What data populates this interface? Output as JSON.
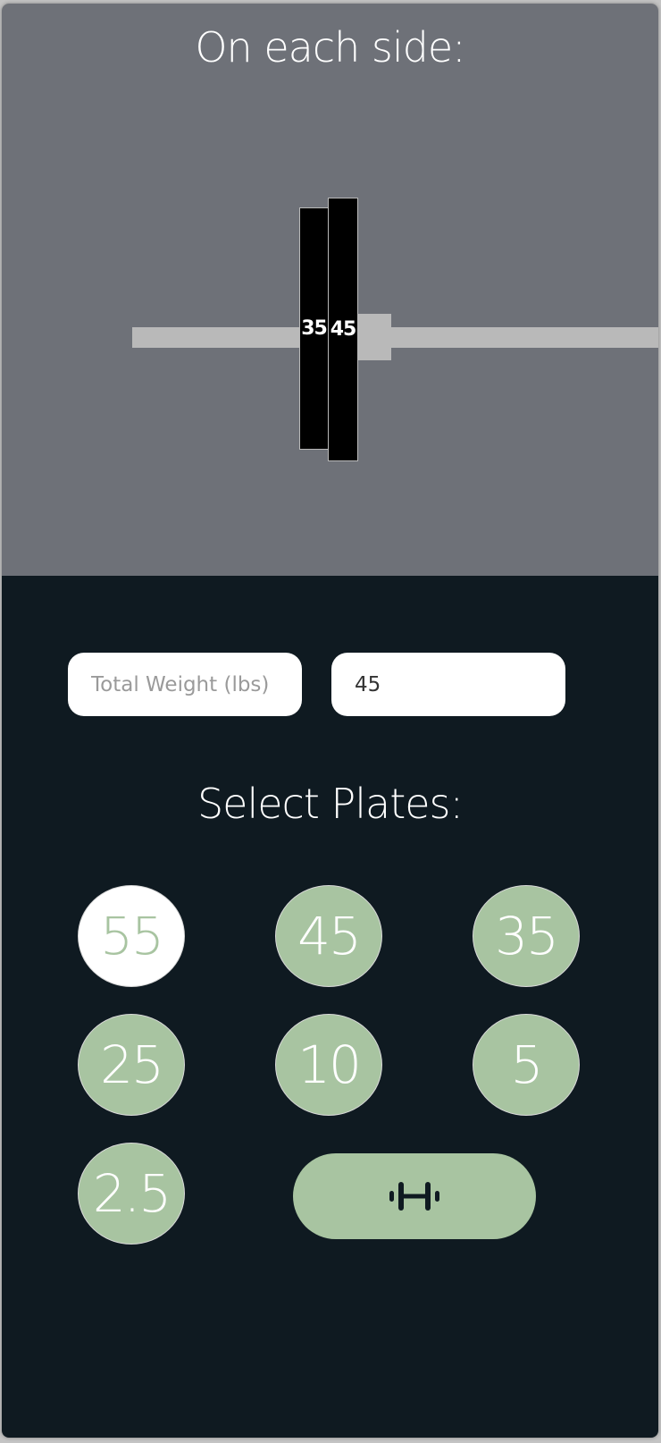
{
  "visualization": {
    "title": "On each side:",
    "plates": [
      {
        "label": "35"
      },
      {
        "label": "45"
      }
    ]
  },
  "controls": {
    "total_weight_placeholder": "Total Weight (lbs)",
    "weight_value": "45",
    "plates_title": "Select Plates:",
    "plate_options": [
      {
        "label": "55",
        "selected": true
      },
      {
        "label": "45",
        "selected": false
      },
      {
        "label": "35",
        "selected": false
      },
      {
        "label": "25",
        "selected": false
      },
      {
        "label": "10",
        "selected": false
      },
      {
        "label": "5",
        "selected": false
      },
      {
        "label": "2.5",
        "selected": false
      }
    ],
    "calculate_icon": "barbell-icon"
  },
  "colors": {
    "top_background": "#6e7178",
    "bottom_background": "#0f1a21",
    "accent_green": "#a8c4a1",
    "bar_gray": "#b9b9b9",
    "plate_black": "#000000"
  }
}
